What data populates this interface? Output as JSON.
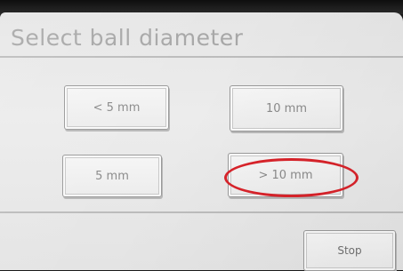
{
  "screen": {
    "title": "Select ball diameter"
  },
  "buttons": {
    "lt5": "< 5 mm",
    "ten": "10 mm",
    "five": "5 mm",
    "gt10": "> 10 mm",
    "stop": "Stop"
  },
  "colors": {
    "highlight_ring": "#d8232a"
  }
}
